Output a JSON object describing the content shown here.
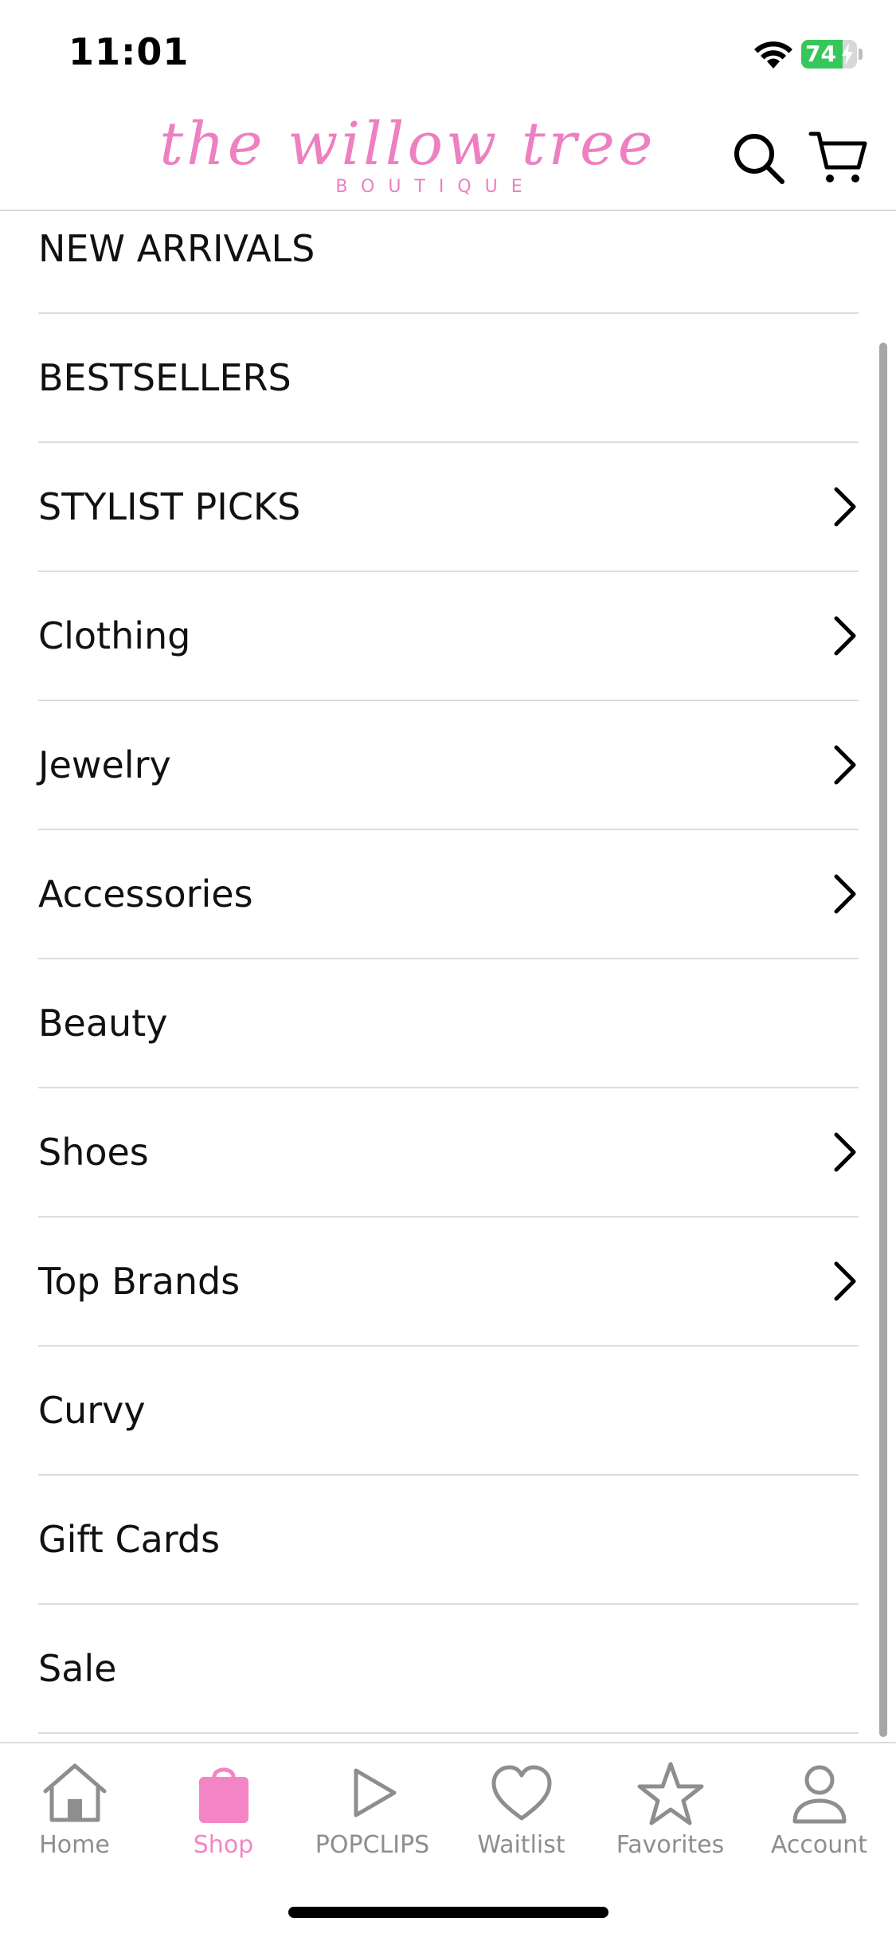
{
  "status_bar": {
    "time": "11:01",
    "battery_percent": "74",
    "battery_level": 0.74,
    "battery_color": "#35c759"
  },
  "header": {
    "logo_script": "the willow tree",
    "logo_sub": "BOUTIQUE",
    "logo_color": "#ee7fc0",
    "search_icon": "search-icon",
    "cart_icon": "cart-icon"
  },
  "menu": {
    "items": [
      {
        "label": "NEW ARRIVALS",
        "has_submenu": false
      },
      {
        "label": "BESTSELLERS",
        "has_submenu": false
      },
      {
        "label": "STYLIST PICKS",
        "has_submenu": true
      },
      {
        "label": "Clothing",
        "has_submenu": true
      },
      {
        "label": "Jewelry",
        "has_submenu": true
      },
      {
        "label": "Accessories",
        "has_submenu": true
      },
      {
        "label": "Beauty",
        "has_submenu": false
      },
      {
        "label": "Shoes",
        "has_submenu": true
      },
      {
        "label": "Top Brands",
        "has_submenu": true
      },
      {
        "label": "Curvy",
        "has_submenu": false
      },
      {
        "label": "Gift Cards",
        "has_submenu": false
      },
      {
        "label": "Sale",
        "has_submenu": false
      }
    ]
  },
  "tabbar": {
    "active_color": "#f385c6",
    "inactive_color": "#8e8e8e",
    "tabs": [
      {
        "label": "Home",
        "icon": "home-icon",
        "active": false
      },
      {
        "label": "Shop",
        "icon": "shopping-bag-icon",
        "active": true
      },
      {
        "label": "POPCLIPS",
        "icon": "play-icon",
        "active": false
      },
      {
        "label": "Waitlist",
        "icon": "heart-icon",
        "active": false
      },
      {
        "label": "Favorites",
        "icon": "star-icon",
        "active": false
      },
      {
        "label": "Account",
        "icon": "person-icon",
        "active": false
      }
    ]
  }
}
